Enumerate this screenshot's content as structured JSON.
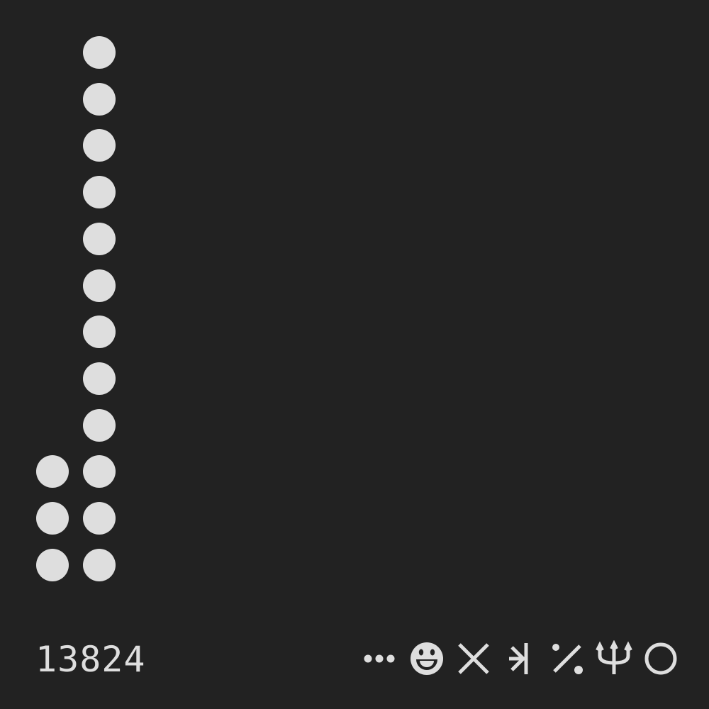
{
  "count": "13824",
  "dot_grid": {
    "rows": 12,
    "columns": [
      {
        "filled_rows": [
          10,
          11,
          12
        ]
      },
      {
        "filled_rows": [
          1,
          2,
          3,
          4,
          5,
          6,
          7,
          8,
          9,
          10,
          11,
          12
        ]
      }
    ]
  },
  "glyphs": [
    "ellipsis-icon",
    "grinning-face-icon",
    "cross-icon",
    "arrow-to-bar-icon",
    "percent-icon",
    "trident-icon",
    "circle-icon"
  ],
  "colors": {
    "background": "#222222",
    "foreground": "#dedede"
  }
}
